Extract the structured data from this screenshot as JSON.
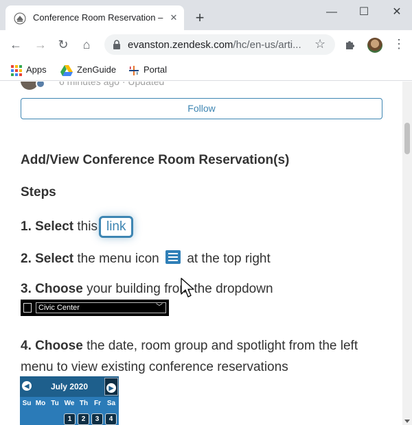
{
  "browser": {
    "tab_title": "Conference Room Reservation – C",
    "tab_close": "✕",
    "new_tab": "+",
    "window_controls": {
      "minimize": "—",
      "maximize": "☐",
      "close": "✕"
    },
    "url_host": "evanston.zendesk.com",
    "url_path": "/hc/en-us/arti...",
    "bookmarks": [
      {
        "label": "Apps",
        "icon": "apps-grid-icon"
      },
      {
        "label": "ZenGuide",
        "icon": "drive-triangle-icon"
      },
      {
        "label": "Portal",
        "icon": "tableau-cross-icon"
      }
    ]
  },
  "article": {
    "meta_text": "6 minutes ago · Updated",
    "follow_label": "Follow",
    "heading": "Add/View Conference Room Reservation(s)",
    "steps_heading": "Steps",
    "step1": {
      "num": "1. Select",
      "text": "this",
      "link": "link"
    },
    "step2": {
      "num": "2. Select",
      "text_before": "the menu icon",
      "text_after": "at the top right"
    },
    "step3": {
      "num": "3. Choose",
      "text": "your building from the dropdown"
    },
    "dropdown_value": "Civic Center",
    "step4": {
      "num": "4. Choose",
      "text": "the date, room group and spotlight from the left menu to view existing conference reservations"
    },
    "calendar": {
      "month": "July 2020",
      "days": [
        "Su",
        "Mo",
        "Tu",
        "We",
        "Th",
        "Fr",
        "Sa"
      ],
      "dates": [
        "1",
        "2",
        "3",
        "4"
      ]
    }
  },
  "colors": {
    "accent": "#3d85b2",
    "text": "#333333",
    "tabstrip": "#dee1e6"
  }
}
